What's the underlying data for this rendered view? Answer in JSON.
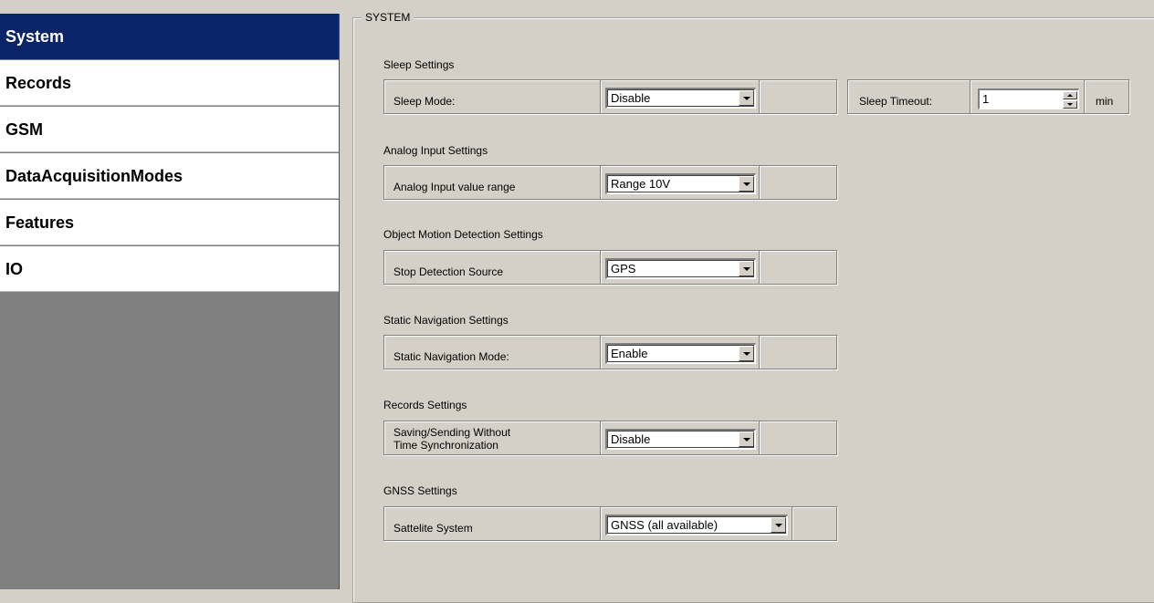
{
  "sidebar": {
    "items": [
      {
        "label": "System",
        "active": true
      },
      {
        "label": "Records",
        "active": false
      },
      {
        "label": "GSM",
        "active": false
      },
      {
        "label": "DataAcquisitionModes",
        "active": false
      },
      {
        "label": "Features",
        "active": false
      },
      {
        "label": "IO",
        "active": false
      }
    ]
  },
  "group": {
    "title": "SYSTEM"
  },
  "sleep": {
    "section": "Sleep Settings",
    "mode_label": "Sleep Mode:",
    "mode_value": "Disable",
    "timeout_label": "Sleep Timeout:",
    "timeout_value": "1",
    "timeout_unit": "min"
  },
  "analog": {
    "section": "Analog Input Settings",
    "label": "Analog Input value range",
    "value": "Range 10V"
  },
  "motion": {
    "section": "Object Motion Detection Settings",
    "label": "Stop Detection Source",
    "value": "GPS"
  },
  "static_nav": {
    "section": "Static Navigation Settings",
    "label": "Static Navigation Mode:",
    "value": "Enable"
  },
  "records": {
    "section": "Records Settings",
    "label_line1": "Saving/Sending Without",
    "label_line2": "Time Synchronization",
    "value": "Disable"
  },
  "gnss": {
    "section": "GNSS Settings",
    "label": "Sattelite System",
    "value": "GNSS (all available)"
  },
  "colors": {
    "active_nav": "#0a246a",
    "panel": "#d4d0c8",
    "sidebar_bg": "#808080"
  }
}
